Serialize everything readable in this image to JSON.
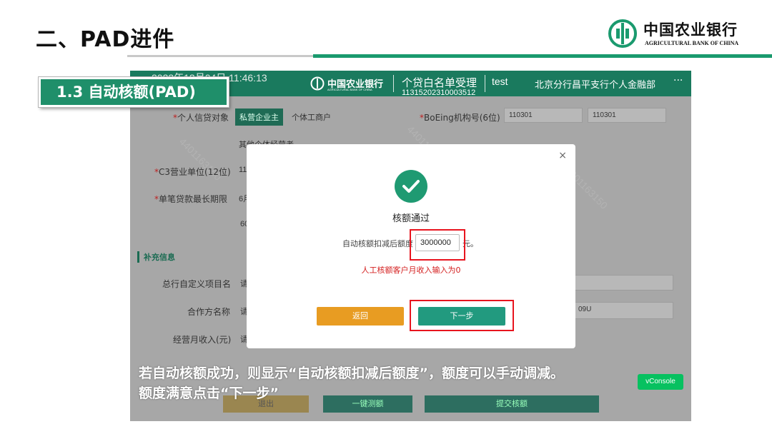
{
  "slide": {
    "title": "二、PAD进件",
    "badge": "1.3  自动核额(PAD)",
    "caption_line1": "若自动核额成功，则显示“自动核额扣减后额度”，额度可以手动调减。",
    "caption_line2": "额度满意点击“下一步”"
  },
  "brand": {
    "name_cn": "中国农业银行",
    "name_en": "AGRICULTURAL BANK OF CHINA"
  },
  "app": {
    "time": "2023年12月04日 11:46:13",
    "bank_cn": "中国农业银行",
    "bank_en": "AGRICULTURAL BANK OF CHINA",
    "module": "个贷白名单受理",
    "code": "11315202310003512",
    "user": "test",
    "dept": "北京分行昌平支行个人金融部",
    "more": "···"
  },
  "form": {
    "borrower_type_label": "个人信贷对象",
    "borrower_type_opt1": "私营企业主",
    "borrower_type_opt2": "个体工商户",
    "borrower_type_opt3": "其他个体经营者",
    "boeing_label": "BoEing机构号(6位)",
    "boeing_val1": "110301",
    "boeing_val2": "110301",
    "c3_label": "C3营业单位(12位)",
    "c3_val": "11",
    "max_term_label": "单笔贷款最长期限",
    "max_term_val": "6月",
    "max_term_val2": "60",
    "section_label": "补充信息",
    "custom_item_label": "总行自定义项目名",
    "custom_item_val": "请",
    "partner_label": "合作方名称",
    "partner_val": "请",
    "partner_right_val": "09U",
    "income_label": "经营月收入(元)",
    "income_val": "请",
    "bottom_btn1": "退出",
    "bottom_btn2": "一键测额",
    "bottom_btn3": "提交核额"
  },
  "modal": {
    "close": "×",
    "title": "核额通过",
    "limit_label": "自动核额扣减后额度",
    "limit_value": "3000000",
    "limit_unit": "元。",
    "warning": "人工核额客户月收入输入为0",
    "back_button": "返回",
    "next_button": "下一步"
  },
  "vconsole": "vConsole",
  "colors": {
    "brand_green": "#1a9a6e",
    "badge_green": "#1f8f6a",
    "highlight_red": "#e8141e",
    "back_orange": "#e89c22",
    "next_teal": "#229a7f"
  }
}
